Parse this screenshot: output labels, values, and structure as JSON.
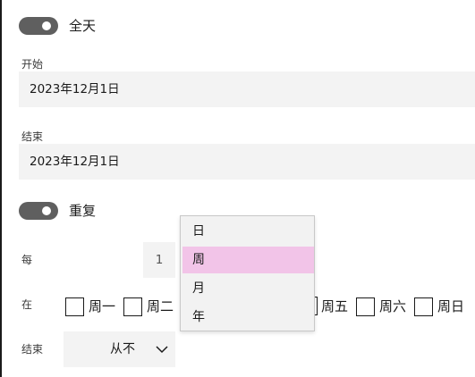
{
  "all_day": {
    "label": "全天",
    "on": true
  },
  "start": {
    "label": "开始",
    "value": "2023年12月1日"
  },
  "end_date": {
    "label": "结束",
    "value": "2023年12月1日"
  },
  "repeat": {
    "label": "重复",
    "on": true
  },
  "every": {
    "label": "每",
    "value": "1"
  },
  "on_days": {
    "label": "在",
    "days": [
      "周一",
      "周二",
      "周五",
      "周六",
      "周日"
    ]
  },
  "end_repeat": {
    "label": "结束",
    "value": "从不"
  },
  "frequency_dropdown": {
    "options": [
      "日",
      "周",
      "月",
      "年"
    ],
    "selected": "周",
    "highlight_color": "#f2c4e8"
  },
  "colors": {
    "toggle_on": "#5f5f5f",
    "field_bg": "#f3f3f3"
  }
}
